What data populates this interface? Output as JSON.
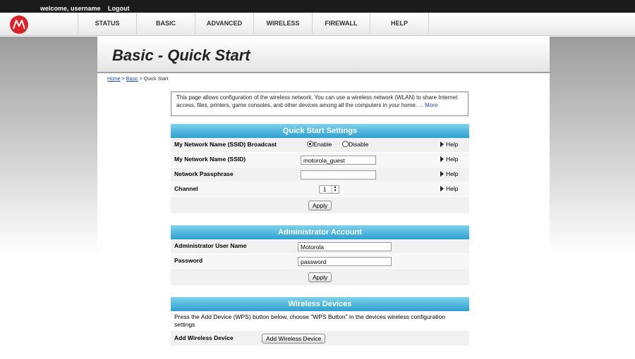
{
  "topbar": {
    "welcome": "welcome, username",
    "logout": "Logout"
  },
  "brand": {
    "logo_icon": "motorola-logo-icon",
    "color": "#d8232a"
  },
  "nav": {
    "tabs": [
      "STATUS",
      "BASIC",
      "ADVANCED",
      "WIRELESS",
      "FIREWALL",
      "HELP"
    ]
  },
  "page": {
    "title": "Basic - Quick Start"
  },
  "breadcrumb": {
    "home": "Home",
    "sep1": " > ",
    "basic": "Basic",
    "sep2": " > ",
    "current": "Quick Start"
  },
  "intro": {
    "text": "This page allows configuration of the wireless network. You can use a wireless network (WLAN) to share Internet access, files, printers, game consoles, and other devices among all the computers in your home.",
    "more": " ... More"
  },
  "quick_start": {
    "heading": "Quick Start Settings",
    "ssid_broadcast_label": "My Network Name (SSID) Broadcast",
    "enable_label": "Enable",
    "disable_label": "Disable",
    "broadcast_selected": "Enable",
    "ssid_label": "My Network Name (SSID)",
    "ssid_value": "motorola_guest",
    "passphrase_label": "Network Passphrase",
    "passphrase_value": "",
    "channel_label": "Channel",
    "channel_value": "1",
    "help_label": "Help",
    "apply_label": "Apply"
  },
  "admin": {
    "heading": "Administrator Account",
    "user_label": "Administrator User Name",
    "user_value": "Motorola",
    "password_label": "Password",
    "password_value": "password",
    "apply_label": "Apply"
  },
  "wireless_devices": {
    "heading": "Wireless Devices",
    "description": "Press the Add Device (WPS) button below, choose \"WPS Button\" in the devices wireless configuration settings",
    "add_label": "Add Wireless Device",
    "add_button": "Add Wireless Device"
  }
}
